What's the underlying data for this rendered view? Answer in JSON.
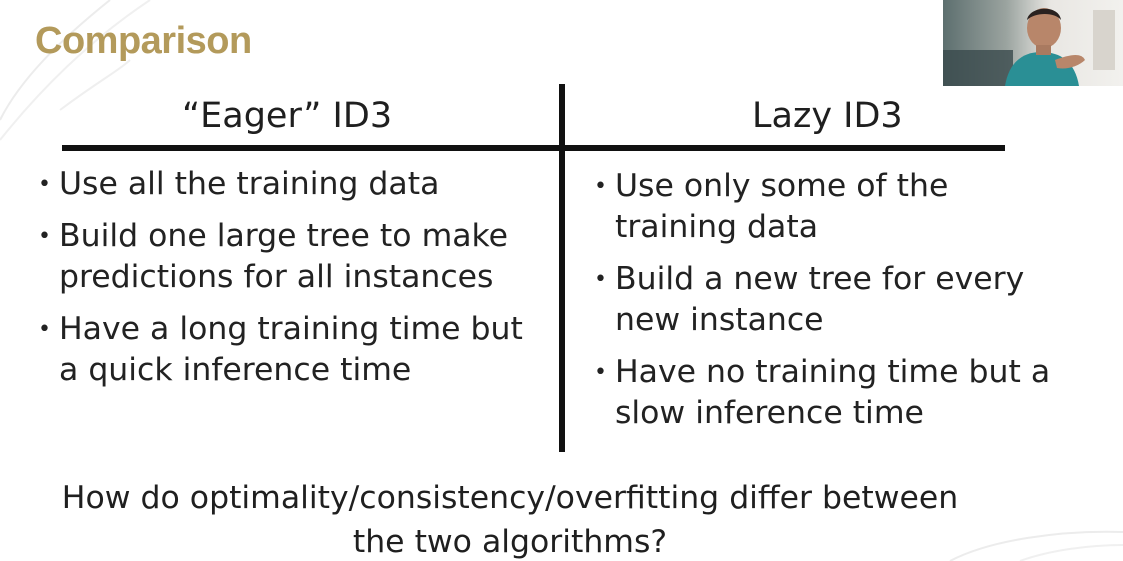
{
  "slide": {
    "title": "Comparison",
    "columns": [
      {
        "heading": "“Eager” ID3",
        "bullets": [
          [
            "Use all the training data"
          ],
          [
            "Build one large tree to make",
            "predictions for all instances"
          ],
          [
            "Have a long training time but",
            "a quick inference time"
          ]
        ]
      },
      {
        "heading": "Lazy ID3",
        "bullets": [
          [
            "Use only some of the",
            "training data"
          ],
          [
            "Build a new tree for every",
            "new instance"
          ],
          [
            "Have no training time but a",
            "slow inference time"
          ]
        ]
      }
    ],
    "question": {
      "line1": "How do optimality/consistency/overfitting differ between",
      "line2": "the two algorithms?"
    }
  },
  "colors": {
    "title": "#b39a5b",
    "text": "#222222",
    "rule": "#111111"
  }
}
